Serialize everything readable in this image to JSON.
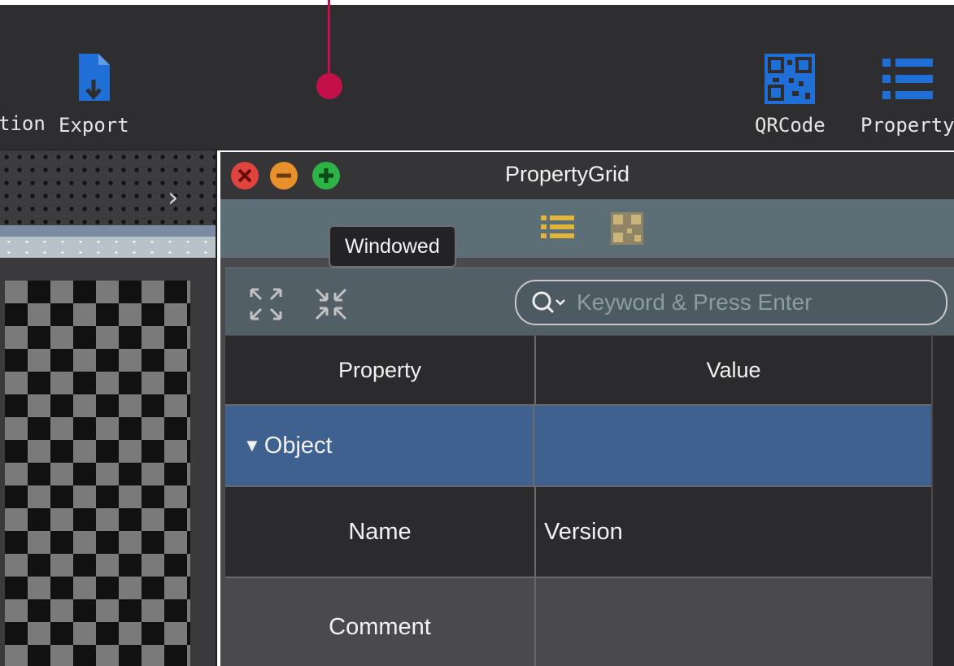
{
  "toolbar": {
    "cut_label": "tion",
    "export_label": "Export",
    "qrcode_label": "QRCode",
    "property_label": "Property",
    "accent_color": "#1f6fd6"
  },
  "window": {
    "title": "PropertyGrid",
    "tooltip": "Windowed"
  },
  "search": {
    "placeholder": "Keyword & Press Enter"
  },
  "table": {
    "headers": [
      "Property",
      "Value"
    ],
    "group": {
      "label": "Object",
      "expanded": true
    },
    "rows": [
      {
        "property": "Name",
        "value": "Version"
      },
      {
        "property": "Comment",
        "value": ""
      }
    ]
  },
  "icons": [
    "export-icon",
    "qrcode-icon",
    "list-icon",
    "close-icon",
    "minimize-icon",
    "zoom-icon",
    "expand-icon",
    "collapse-icon",
    "search-icon",
    "chevron-right-icon",
    "disclosure-triangle-icon"
  ]
}
